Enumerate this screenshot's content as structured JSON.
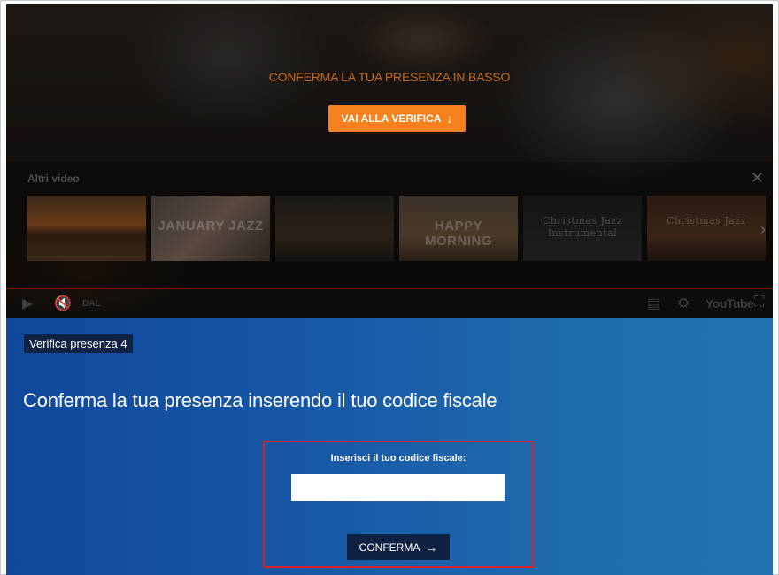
{
  "player": {
    "overlay_text": "CONFERMA LA TUA PRESENZA IN BASSO",
    "overlay_button": "VAI ALLA VERIFICA",
    "overlay_button_icon": "↓",
    "more_videos": {
      "title": "Altri video",
      "close_icon": "✕",
      "next_icon": "›",
      "thumbnails": [
        {
          "label": "",
          "style": "palms"
        },
        {
          "label": "JANUARY JAZZ",
          "style": "coffee"
        },
        {
          "label": "",
          "style": "night"
        },
        {
          "label": "HAPPY MORNING",
          "style": "morning"
        },
        {
          "label": "Christmas Jazz\nInstrumental",
          "style": "dark"
        },
        {
          "label": "Christmas Jazz",
          "style": "warm"
        }
      ]
    },
    "controls": {
      "play_icon": "▶",
      "mute_icon": "🔇",
      "live_label": "DAL",
      "cc_icon": "▤",
      "gear_icon": "⚙",
      "youtube_label": "YouTube",
      "fullscreen_icon": "⛶"
    }
  },
  "verify": {
    "badge": "Verifica presenza 4",
    "heading": "Conferma la tua presenza inserendo il tuo codice fiscale",
    "field_label": "Inserisci il tuo codice fiscale:",
    "field_value": "",
    "field_placeholder": "",
    "confirm_label": "CONFERMA",
    "confirm_icon": "→"
  }
}
